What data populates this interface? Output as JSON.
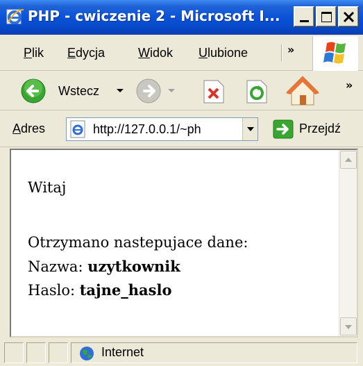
{
  "window": {
    "title": "PHP - cwiczenie 2 - Microsoft I..."
  },
  "menu": {
    "items": [
      {
        "prefix": "",
        "underline": "P",
        "rest": "lik"
      },
      {
        "prefix": "",
        "underline": "E",
        "rest": "dycja"
      },
      {
        "prefix": "",
        "underline": "W",
        "rest": "idok"
      },
      {
        "prefix": "",
        "underline": "U",
        "rest": "lubione"
      }
    ],
    "more": "»"
  },
  "toolbar": {
    "back_label": "Wstecz",
    "more": "»"
  },
  "address": {
    "label_underline": "A",
    "label_rest": "dres",
    "url": "http://127.0.0.1/~ph",
    "go_label": "Przejdź"
  },
  "page": {
    "greeting": "Witaj",
    "received": "Otrzymano nastepujace dane:",
    "name_label": "Nazwa: ",
    "name_value": "uzytkownik",
    "password_label": "Haslo: ",
    "password_value": "tajne_haslo"
  },
  "status": {
    "zone": "Internet"
  },
  "colors": {
    "titlebar": "#0a52d8",
    "chrome": "#ece9d8",
    "back_green": "#3aa632",
    "stop_red": "#d9322b"
  }
}
